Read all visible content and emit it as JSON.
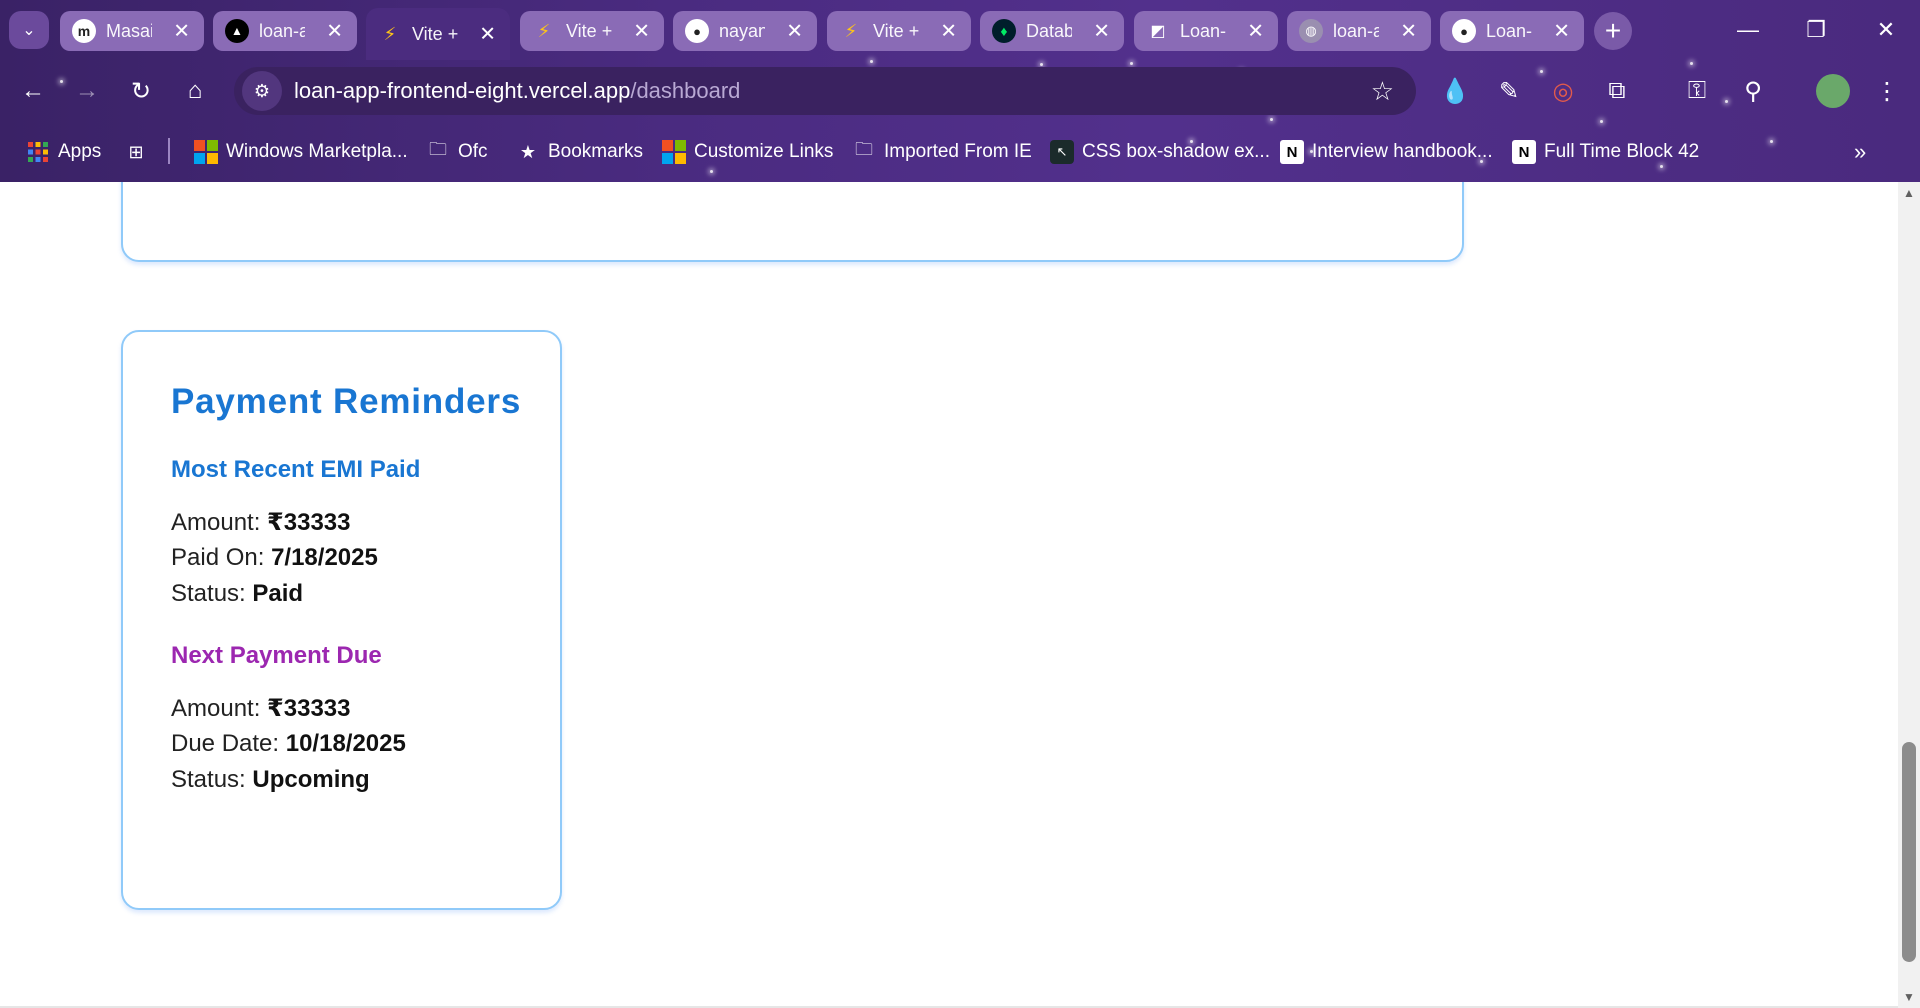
{
  "tabs": [
    {
      "title": "Masai",
      "icon": "masai-icon",
      "active": false
    },
    {
      "title": "loan-a",
      "icon": "vercel-icon",
      "active": false
    },
    {
      "title": "Vite +",
      "icon": "vite-icon",
      "active": true
    },
    {
      "title": "Vite +",
      "icon": "vite-icon",
      "active": false
    },
    {
      "title": "nayan",
      "icon": "github-icon",
      "active": false
    },
    {
      "title": "Vite +",
      "icon": "vite-icon",
      "active": false
    },
    {
      "title": "Datab",
      "icon": "mongodb-icon",
      "active": false
    },
    {
      "title": "Loan-",
      "icon": "render-icon",
      "active": false
    },
    {
      "title": "loan-a",
      "icon": "globe-icon",
      "active": false
    },
    {
      "title": "Loan-",
      "icon": "github-icon",
      "active": false
    }
  ],
  "address_bar": {
    "host": "loan-app-frontend-eight.vercel.app",
    "path": "/dashboard"
  },
  "bookmarks": [
    {
      "label": "Apps",
      "icon": "apps-grid-icon"
    },
    {
      "label": "Windows Marketpla...",
      "icon": "microsoft-icon"
    },
    {
      "label": "Ofc",
      "icon": "folder-icon"
    },
    {
      "label": "Bookmarks",
      "icon": "star-icon"
    },
    {
      "label": "Customize Links",
      "icon": "microsoft-icon"
    },
    {
      "label": "Imported From IE",
      "icon": "folder-icon"
    },
    {
      "label": "CSS box-shadow ex...",
      "icon": "cursor-icon"
    },
    {
      "label": "Interview handbook...",
      "icon": "notion-icon"
    },
    {
      "label": "Full Time Block 42",
      "icon": "notion-icon"
    }
  ],
  "reminders": {
    "title": "Payment Reminders",
    "recent": {
      "heading": "Most Recent EMI Paid",
      "amount_label": "Amount: ",
      "amount": "₹33333",
      "date_label": "Paid On: ",
      "date": "7/18/2025",
      "status_label": "Status: ",
      "status": "Paid"
    },
    "next": {
      "heading": "Next Payment Due",
      "amount_label": "Amount: ",
      "amount": "₹33333",
      "date_label": "Due Date: ",
      "date": "10/18/2025",
      "status_label": "Status: ",
      "status": "Upcoming"
    }
  },
  "colors": {
    "accent_blue": "#1976d2",
    "accent_purple": "#9c27b0",
    "card_border": "#90caf9",
    "chrome_purple": "#4a2b80"
  }
}
